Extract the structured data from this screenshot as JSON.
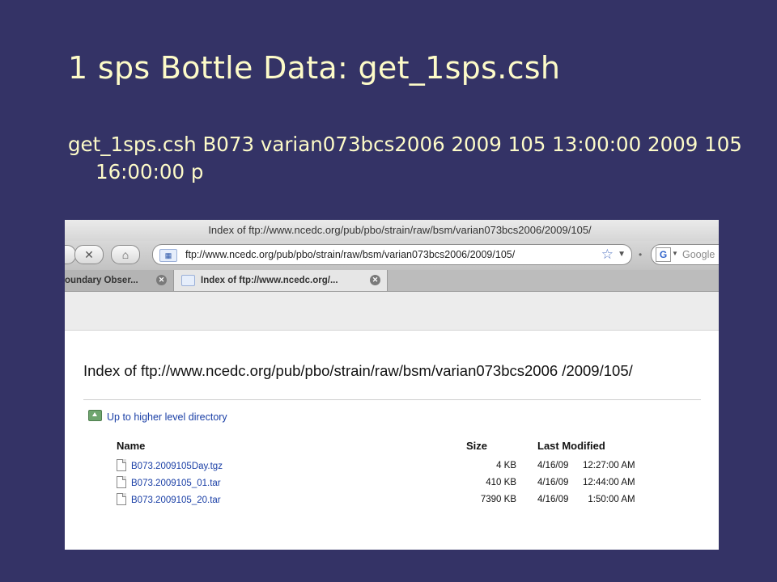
{
  "slide": {
    "title": "1 sps Bottle Data:  get_1sps.csh",
    "command": "get_1sps.csh B073 varian073bcs2006  2009 105 13:00:00 2009 105 16:00:00 p"
  },
  "browser": {
    "window_title": "Index of ftp://www.ncedc.org/pub/pbo/strain/raw/bsm/varian073bcs2006/2009/105/",
    "url": "ftp://www.ncedc.org/pub/pbo/strain/raw/bsm/varian073bcs2006/2009/105/",
    "search_placeholder": "Google",
    "tabs": [
      {
        "label": "oundary Obser..."
      },
      {
        "label": "Index of ftp://www.ncedc.org/..."
      }
    ]
  },
  "page": {
    "heading": "Index of ftp://www.ncedc.org/pub/pbo/strain/raw/bsm/varian073bcs2006 /2009/105/",
    "up_link": "Up to higher level directory",
    "columns": {
      "name": "Name",
      "size": "Size",
      "modified": "Last Modified"
    },
    "files": [
      {
        "name": "B073.2009105Day.tgz",
        "size": "4 KB",
        "date": "4/16/09",
        "time": "12:27:00 AM"
      },
      {
        "name": "B073.2009105_01.tar",
        "size": "410 KB",
        "date": "4/16/09",
        "time": "12:44:00 AM"
      },
      {
        "name": "B073.2009105_20.tar",
        "size": "7390 KB",
        "date": "4/16/09",
        "time": "1:50:00 AM"
      }
    ]
  },
  "colors": {
    "slide_background": "#343366",
    "slide_text": "#fdfbc8",
    "link": "#1a3fa6"
  }
}
